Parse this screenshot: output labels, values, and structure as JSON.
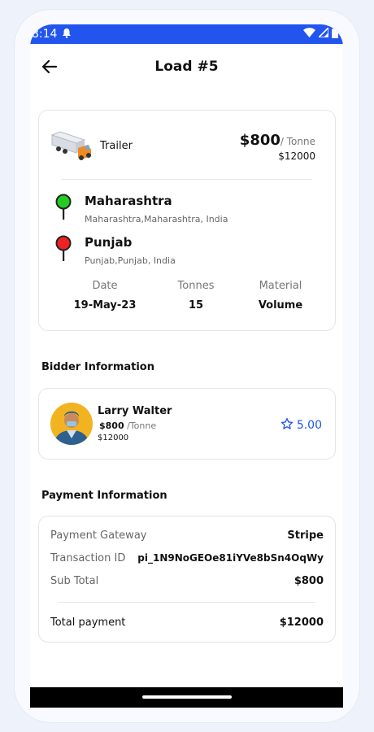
{
  "status_bar": {
    "time": "8:14"
  },
  "header": {
    "title": "Load #5"
  },
  "load": {
    "vehicle_type": "Trailer",
    "price": "$800",
    "price_unit": "/ Tonne",
    "price_total": "$12000",
    "origin": {
      "name": "Maharashtra",
      "address": "Maharashtra,Maharashtra, India"
    },
    "destination": {
      "name": "Punjab",
      "address": "Punjab,Punjab, India"
    },
    "stats": [
      {
        "label": "Date",
        "value": "19-May-23"
      },
      {
        "label": "Tonnes",
        "value": "15"
      },
      {
        "label": "Material",
        "value": "Volume"
      }
    ]
  },
  "bidder": {
    "heading": "Bidder Information",
    "name": "Larry Walter",
    "price": "$800",
    "price_unit": "/Tonne",
    "total": "$12000",
    "rating": "5.00"
  },
  "payment": {
    "heading": "Payment Information",
    "rows": [
      {
        "label": "Payment Gateway",
        "value": "Stripe"
      },
      {
        "label": "Transaction ID",
        "value": "pi_1N9NoGEOe81iYVe8bSn4OqWy"
      },
      {
        "label": "Sub Total",
        "value": "$800"
      }
    ],
    "total_label": "Total payment",
    "total_value": "$12000"
  },
  "colors": {
    "accent": "#2255ee",
    "origin_pin": "#22cc22",
    "destination_pin": "#ee2222"
  }
}
